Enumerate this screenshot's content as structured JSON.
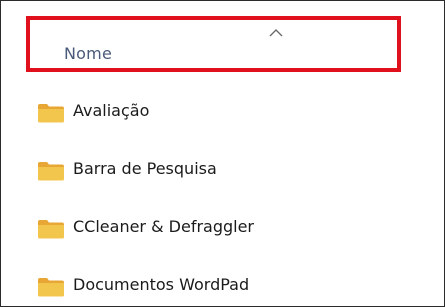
{
  "header": {
    "column_name": "Nome",
    "sort_direction": "ascending",
    "highlight_color": "#e0101c"
  },
  "items": [
    {
      "name": "Avaliação",
      "icon": "folder-icon"
    },
    {
      "name": "Barra de Pesquisa",
      "icon": "folder-icon"
    },
    {
      "name": "CCleaner & Defraggler",
      "icon": "folder-icon"
    },
    {
      "name": "Documentos WordPad",
      "icon": "folder-icon"
    }
  ],
  "colors": {
    "folder_front": "#f2c54d",
    "folder_back": "#e8a735",
    "header_text": "#4a5a7a",
    "item_text": "#1b1b1b"
  }
}
